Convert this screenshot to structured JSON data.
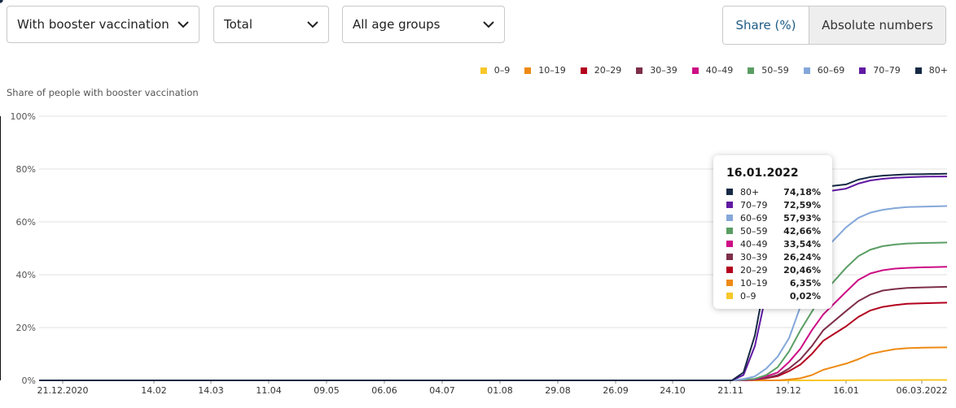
{
  "filters": {
    "vaccination": "With booster vaccination",
    "region": "Total",
    "age": "All age groups"
  },
  "toggle": {
    "share": "Share (%)",
    "absolute": "Absolute numbers"
  },
  "chart_data": {
    "type": "line",
    "ylabel": "Share of people with booster vaccination",
    "ylim": [
      0,
      100
    ],
    "y_ticks": [
      "0%",
      "20%",
      "40%",
      "60%",
      "80%",
      "100%"
    ],
    "x_ticks": [
      "21.12.2020",
      "14.02",
      "14.03",
      "11.04",
      "09.05",
      "06.06",
      "04.07",
      "01.08",
      "29.08",
      "26.09",
      "24.10",
      "21.11",
      "19.12",
      "16.01",
      "06.03.2022"
    ],
    "x": [
      "21.12.2020",
      "24.10",
      "31.10",
      "07.11",
      "14.11",
      "21.11",
      "28.11",
      "05.12",
      "12.12",
      "19.12",
      "26.12",
      "02.01",
      "09.01",
      "16.01",
      "23.01",
      "30.01",
      "06.02",
      "13.02",
      "20.02",
      "27.02",
      "06.03.2022"
    ],
    "grid": true,
    "legend_position": "top-right",
    "series": [
      {
        "name": "0–9",
        "color": "#f7c829",
        "values": [
          0,
          0,
          0,
          0,
          0,
          0,
          0,
          0,
          0,
          0,
          0,
          0,
          0,
          0.02,
          0.05,
          0.08,
          0.1,
          0.12,
          0.13,
          0.14,
          0.15
        ]
      },
      {
        "name": "10–19",
        "color": "#ee8a13",
        "values": [
          0,
          0,
          0,
          0,
          0,
          0,
          0,
          0,
          0,
          0.3,
          0.8,
          2,
          4,
          6.35,
          8,
          10,
          11,
          11.8,
          12.2,
          12.4,
          12.5
        ]
      },
      {
        "name": "20–29",
        "color": "#b3001e",
        "values": [
          0,
          0,
          0,
          0,
          0,
          0,
          0.3,
          0.8,
          1.6,
          3.5,
          6,
          10,
          15,
          20.46,
          24,
          26.5,
          27.8,
          28.5,
          29,
          29.2,
          29.4
        ]
      },
      {
        "name": "30–39",
        "color": "#7d2e4a",
        "values": [
          0,
          0,
          0,
          0,
          0,
          0,
          0.3,
          1,
          2,
          4.5,
          8,
          13,
          19,
          26.24,
          30,
          32.5,
          34,
          34.6,
          35,
          35.2,
          35.4
        ]
      },
      {
        "name": "40–49",
        "color": "#cc0d85",
        "values": [
          0,
          0,
          0,
          0,
          0,
          0,
          0.4,
          1.5,
          3,
          7,
          12,
          19,
          25,
          33.54,
          38,
          40.5,
          41.7,
          42.3,
          42.6,
          42.8,
          43
        ]
      },
      {
        "name": "50–59",
        "color": "#5a9e64",
        "values": [
          0,
          0,
          0,
          0,
          0,
          0.2,
          0.6,
          2,
          5,
          11,
          19,
          26,
          33,
          42.66,
          47,
          49.5,
          50.8,
          51.4,
          51.8,
          52,
          52.2
        ]
      },
      {
        "name": "60–69",
        "color": "#84a7d9",
        "values": [
          0,
          0,
          0,
          0,
          0,
          0.5,
          1.5,
          4.5,
          9,
          16,
          28,
          39,
          49,
          57.93,
          61.5,
          63.5,
          64.6,
          65.2,
          65.6,
          65.8,
          66
        ]
      },
      {
        "name": "70–79",
        "color": "#6119a3",
        "values": [
          0,
          0,
          0,
          0,
          0,
          2,
          13,
          33,
          50,
          60,
          66,
          69.5,
          71.3,
          72.59,
          74.5,
          75.7,
          76.3,
          76.7,
          76.9,
          77.1,
          77.2
        ]
      },
      {
        "name": "80+",
        "color": "#172a45",
        "values": [
          0,
          0,
          0,
          0,
          0,
          3,
          17,
          40,
          58,
          66,
          70,
          72,
          73.2,
          74.18,
          76,
          77,
          77.5,
          77.8,
          78,
          78.1,
          78.2
        ]
      }
    ],
    "tooltip": {
      "date": "16.01.2022",
      "rows": [
        {
          "label": "80+",
          "value": "74,18%",
          "color": "#172a45"
        },
        {
          "label": "70–79",
          "value": "72,59%",
          "color": "#6119a3"
        },
        {
          "label": "60–69",
          "value": "57,93%",
          "color": "#84a7d9"
        },
        {
          "label": "50–59",
          "value": "42,66%",
          "color": "#5a9e64"
        },
        {
          "label": "40–49",
          "value": "33,54%",
          "color": "#cc0d85"
        },
        {
          "label": "30–39",
          "value": "26,24%",
          "color": "#7d2e4a"
        },
        {
          "label": "20–29",
          "value": "20,46%",
          "color": "#b3001e"
        },
        {
          "label": "10–19",
          "value": "6,35%",
          "color": "#ee8a13"
        },
        {
          "label": "0–9",
          "value": "0,02%",
          "color": "#f7c829"
        }
      ]
    }
  }
}
